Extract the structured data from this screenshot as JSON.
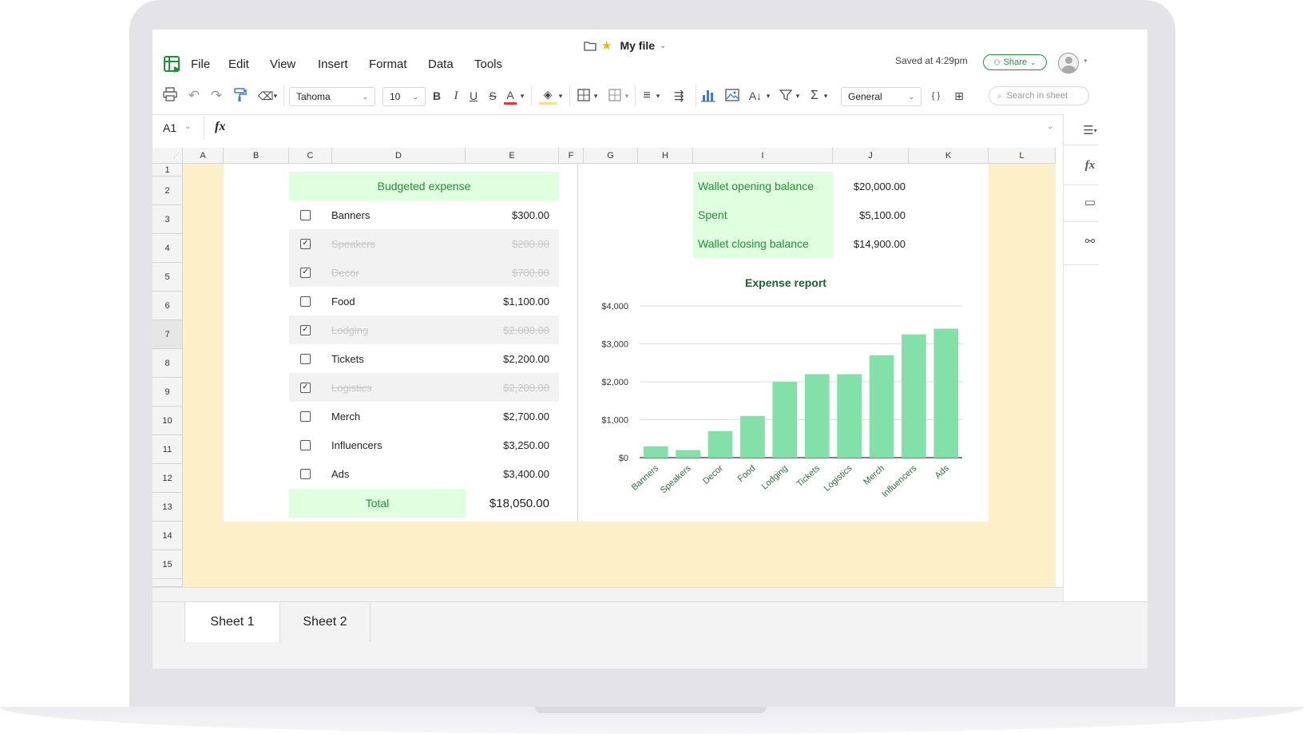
{
  "file": {
    "name": "My file",
    "saved": "Saved at 4:29pm",
    "share": "Share"
  },
  "menu": [
    "File",
    "Edit",
    "View",
    "Insert",
    "Format",
    "Data",
    "Tools"
  ],
  "toolbar": {
    "font": "Tahoma",
    "size": "10",
    "number_format": "General",
    "search_placeholder": "Search in sheet",
    "bold": "B",
    "italic": "I",
    "underline": "U",
    "strike": "S",
    "font_color": "A",
    "sum": "Σ",
    "braces": "{ }"
  },
  "formula": {
    "cell_ref": "A1",
    "fx": "fx"
  },
  "columns": [
    "A",
    "B",
    "C",
    "D",
    "E",
    "F",
    "G",
    "H",
    "I",
    "J",
    "K",
    "L"
  ],
  "rows": [
    "1",
    "2",
    "3",
    "4",
    "5",
    "6",
    "7",
    "8",
    "9",
    "10",
    "11",
    "12",
    "13",
    "14",
    "15"
  ],
  "budget": {
    "header": "Budgeted expense",
    "items": [
      {
        "name": "Banners",
        "amount": "$300.00",
        "checked": false
      },
      {
        "name": "Speakers",
        "amount": "$200.00",
        "checked": true
      },
      {
        "name": "Decor",
        "amount": "$700.00",
        "checked": true
      },
      {
        "name": "Food",
        "amount": "$1,100.00",
        "checked": false
      },
      {
        "name": "Lodging",
        "amount": "$2,000.00",
        "checked": true
      },
      {
        "name": "Tickets",
        "amount": "$2,200.00",
        "checked": false
      },
      {
        "name": "Logistics",
        "amount": "$2,200.00",
        "checked": true
      },
      {
        "name": "Merch",
        "amount": "$2,700.00",
        "checked": false
      },
      {
        "name": "Influencers",
        "amount": "$3,250.00",
        "checked": false
      },
      {
        "name": "Ads",
        "amount": "$3,400.00",
        "checked": false
      }
    ],
    "total_label": "Total",
    "total_value": "$18,050.00"
  },
  "wallet": {
    "opening_label": "Wallet opening balance",
    "opening_value": "$20,000.00",
    "spent_label": "Spent",
    "spent_value": "$5,100.00",
    "closing_label": "Wallet closing balance",
    "closing_value": "$14,900.00"
  },
  "chart_data": {
    "type": "bar",
    "title": "Expense report",
    "categories": [
      "Banners",
      "Speakers",
      "Decor",
      "Food",
      "Lodging",
      "Tickets",
      "Logistics",
      "Merch",
      "Influencers",
      "Ads"
    ],
    "values": [
      300,
      200,
      700,
      1100,
      2000,
      2200,
      2200,
      2700,
      3250,
      3400
    ],
    "ylim": [
      0,
      4000
    ],
    "yticks": [
      "$0",
      "$1,000",
      "$2,000",
      "$3,000",
      "$4,000"
    ],
    "color": "#82e0a8",
    "grid": true
  },
  "sheets": [
    "Sheet 1",
    "Sheet 2"
  ],
  "colors": {
    "accent": "#1f8f3a",
    "header_fill": "#dfffdf",
    "margin_fill": "#fdf0c8"
  }
}
